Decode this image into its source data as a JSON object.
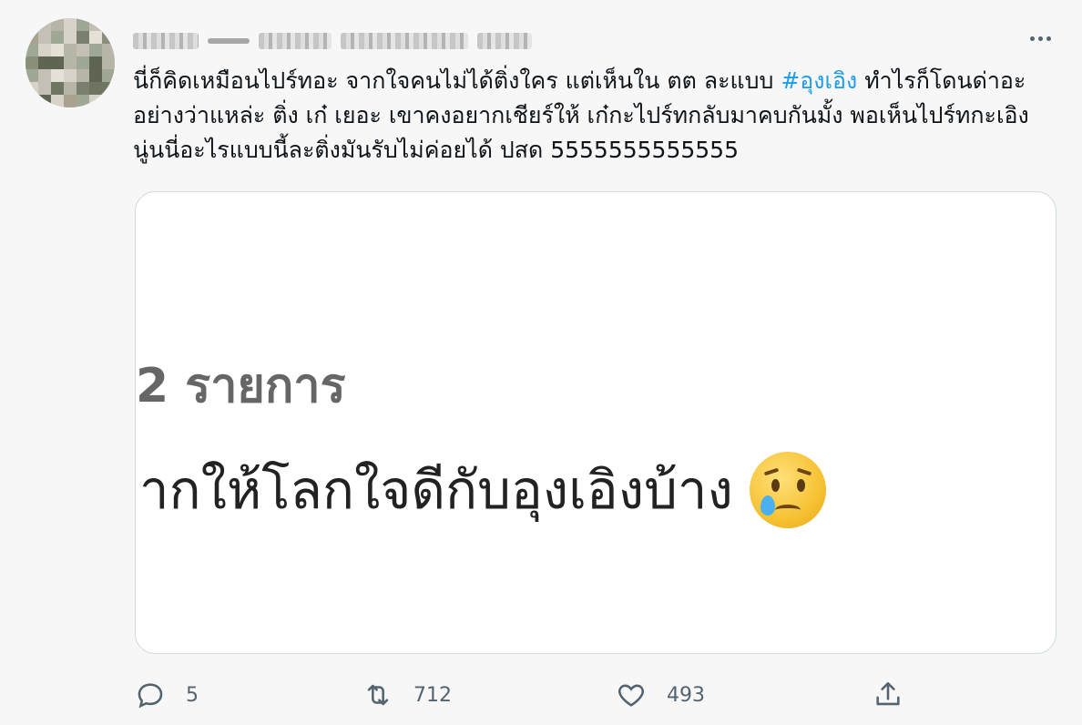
{
  "tweet": {
    "text_before_hashtag": "นี่ก็คิดเหมือนไปร์ทอะ จากใจคนไม่ได้ติ่งใคร แต่เห็นใน ตต ละแบบ ",
    "hashtag": "#อุงเอิง",
    "text_after_hashtag": " ทำไรก็โดนด่าอะ อย่างว่าแหล่ะ ติ่ง เก๋ เยอะ เขาคงอยากเชียร์ให้ เก๋กะไปร์ทกลับมาคบกันมั้ง พอเห็นไปร์ทกะเอิง นู่นนี่อะไรแบบนี้ละติ่งมันรับไม่ค่อยได้ ปสด 5555555555555"
  },
  "media": {
    "line1": "2 รายการ",
    "line2": "ยากให้โลกใจดีกับอุงเอิงบ้าง",
    "emoji": "crying-face-emoji"
  },
  "actions": {
    "reply_count": "5",
    "retweet_count": "712",
    "like_count": "493"
  },
  "colors": {
    "hashtag": "#1d9bf0",
    "icon": "#536471",
    "card_border": "#cfd9de"
  }
}
